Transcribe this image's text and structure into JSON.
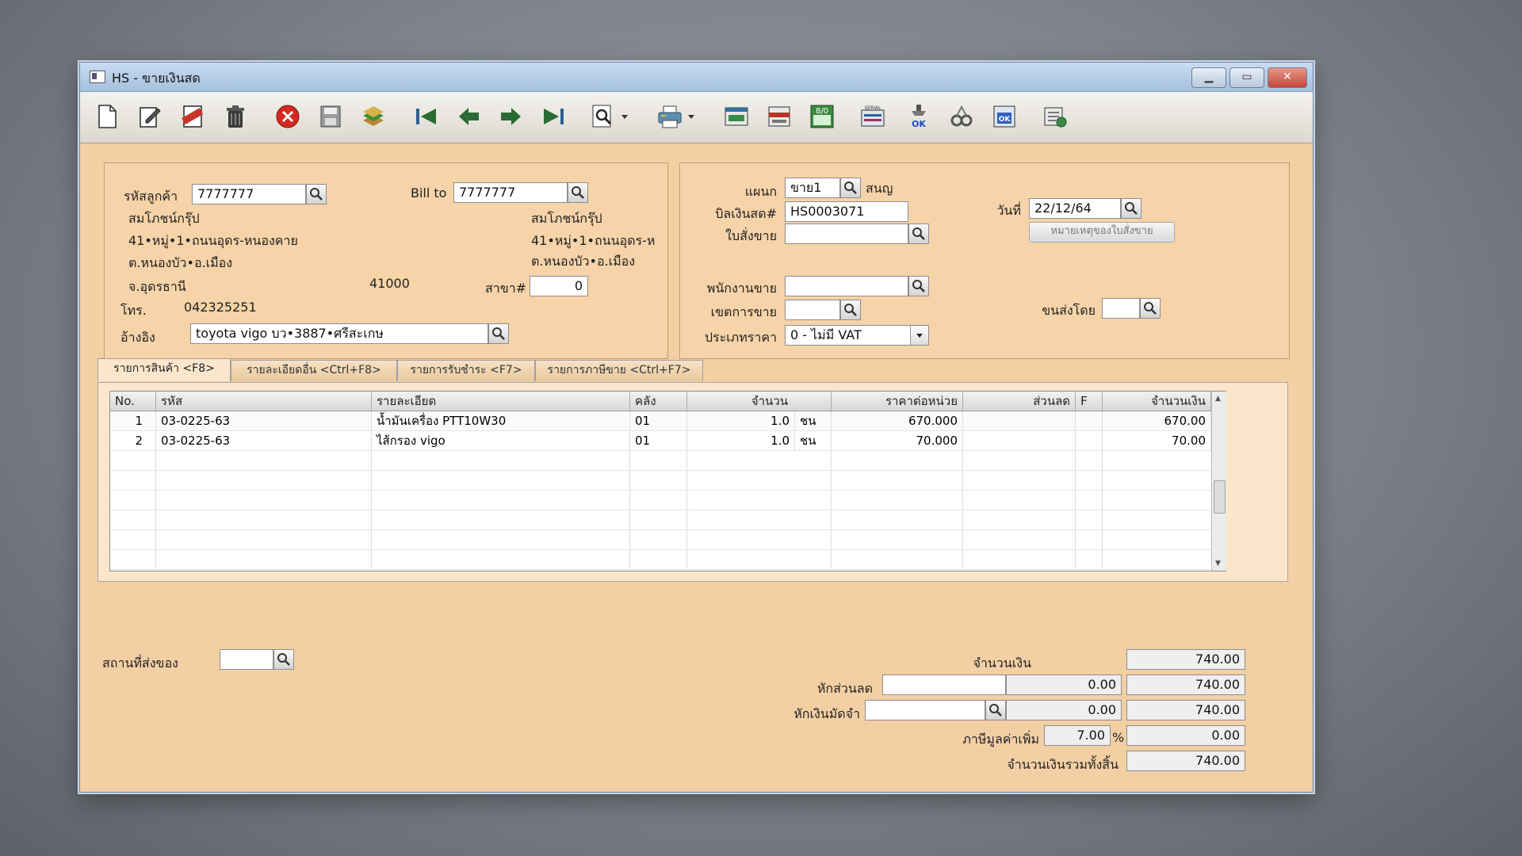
{
  "window": {
    "title": "HS - ขายเงินสด"
  },
  "toolbar": {
    "icons": [
      "new-doc-icon",
      "edit-icon",
      "void-icon",
      "trash-icon",
      "cancel-icon",
      "save-icon",
      "stack-icon",
      "first-record-icon",
      "prev-record-icon",
      "next-record-icon",
      "last-record-icon",
      "find-icon",
      "print-icon",
      "report-icon",
      "book-icon",
      "calc-icon",
      "serial-icon",
      "approve-icon",
      "link-icon",
      "ok-icon",
      "settings-icon"
    ],
    "calc_label": "8/0",
    "serial_label": "SERIAL",
    "approve_label": "OK",
    "ok_label": "OK"
  },
  "customer": {
    "code_label": "รหัสลูกค้า",
    "code": "7777777",
    "billto_label": "Bill to",
    "billto_code": "7777777",
    "name": "สมโภชน์กรุ๊ป",
    "addr1": "41•หมู่•1•ถนนอุดร-หนองคาย",
    "addr2": "ต.หนองบัว•อ.เมือง",
    "province": "จ.อุดรธานี",
    "zip": "41000",
    "billto_name": "สมโภชน์กรุ๊ป",
    "billto_addr1": "41•หมู่•1•ถนนอุดร-ห",
    "billto_addr2": "ต.หนองบัว•อ.เมือง",
    "branch_label": "สาขา#",
    "branch": "0",
    "phone_label": "โทร.",
    "phone": "042325251",
    "ref_label": "อ้างอิง",
    "ref": "toyota vigo บว•3887•ศรีสะเกษ"
  },
  "doc": {
    "dept_label": "แผนก",
    "dept": "ขาย1",
    "dept_name": "สนญ",
    "bill_label": "บิลเงินสด#",
    "bill_no": "HS0003071",
    "date_label": "วันที่",
    "date": "22/12/64",
    "order_label": "ใบสั่งขาย",
    "order_note_button": "หมายเหตุของใบสั่งขาย",
    "salesman_label": "พนักงานขาย",
    "area_label": "เขตการขาย",
    "ship_label": "ขนส่งโดย",
    "price_type_label": "ประเภทราคา",
    "price_type": "0 - ไม่มี VAT"
  },
  "tabs": [
    {
      "label": "รายการสินค้า <F8>"
    },
    {
      "label": "รายละเอียดอื่น <Ctrl+F8>"
    },
    {
      "label": "รายการรับชำระ <F7>"
    },
    {
      "label": "รายการภาษีขาย <Ctrl+F7>"
    }
  ],
  "grid": {
    "headers": [
      "No.",
      "รหัส",
      "รายละเอียด",
      "คลัง",
      "จำนวน",
      "ราคาต่อหน่วย",
      "ส่วนลด",
      "F",
      "จำนวนเงิน"
    ],
    "rows": [
      {
        "no": "1",
        "code": "03-0225-63",
        "desc": "น้ำมันเครื่อง PTT10W30",
        "wh": "01",
        "qty": "1.0",
        "unit": "ชน",
        "price": "670.000",
        "disc": "",
        "f": "",
        "amount": "670.00"
      },
      {
        "no": "2",
        "code": "03-0225-63",
        "desc": "ไส้กรอง vigo",
        "wh": "01",
        "qty": "1.0",
        "unit": "ชน",
        "price": "70.000",
        "disc": "",
        "f": "",
        "amount": "70.00"
      }
    ]
  },
  "footer": {
    "ship_place_label": "สถานที่ส่งของ",
    "amount_label": "จำนวนเงิน",
    "amount": "740.00",
    "discount_label": "หักส่วนลด",
    "discount": "0.00",
    "after_discount": "740.00",
    "deposit_label": "หักเงินมัดจำ",
    "deposit": "0.00",
    "after_deposit": "740.00",
    "vat_label": "ภาษีมูลค่าเพิ่ม",
    "vat_rate": "7.00",
    "vat_pct": "%",
    "vat_amount": "0.00",
    "total_label": "จำนวนเงินรวมทั้งสิ้น",
    "total": "740.00"
  }
}
